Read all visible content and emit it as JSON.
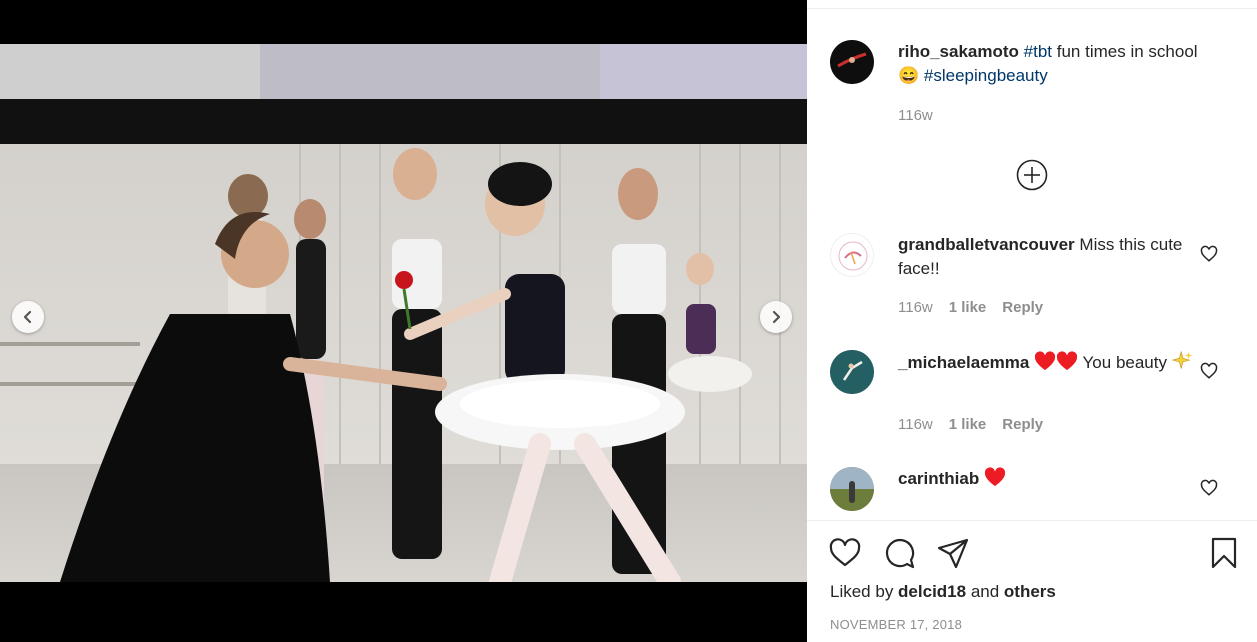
{
  "post": {
    "username": "riho_sakamoto",
    "caption_hashtag_1": "#tbt",
    "caption_text_1": " fun times in school ",
    "caption_emoji": "😄",
    "caption_hashtag_2": "#sleepingbeauty",
    "time": "116w"
  },
  "comments": [
    {
      "username": "grandballetvancouver",
      "text": "Miss this cute face!!",
      "time": "116w",
      "likes": "1 like",
      "reply": "Reply"
    },
    {
      "username": "_michaelaemma",
      "text": "You beauty",
      "time": "116w",
      "likes": "1 like",
      "reply": "Reply"
    },
    {
      "username": "carinthiab",
      "text": ""
    }
  ],
  "likes": {
    "prefix": "Liked by ",
    "user": "delcid18",
    "middle": " and ",
    "others": "others"
  },
  "date": "NOVEMBER 17, 2018",
  "icons": [
    "chevron-left-icon",
    "chevron-right-icon",
    "plus-circle-icon",
    "heart-icon",
    "comment-icon",
    "share-icon",
    "bookmark-icon"
  ],
  "colors": {
    "heart_red": "#ed1c24",
    "hashtag": "#00376b",
    "meta_gray": "#8e8e8e"
  }
}
